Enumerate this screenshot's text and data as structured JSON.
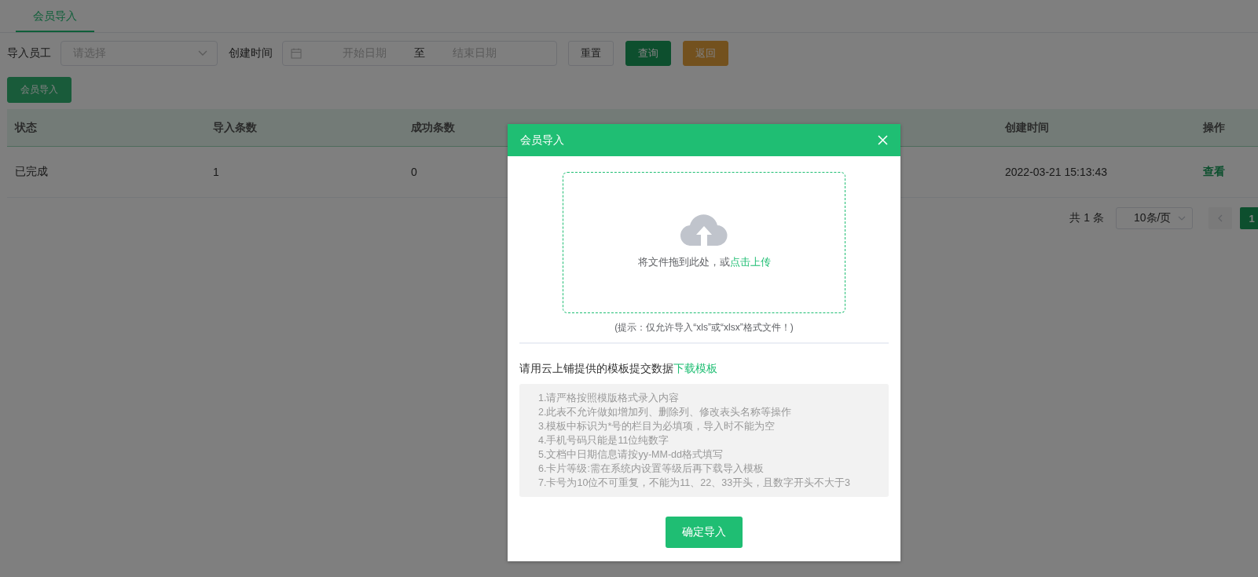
{
  "tabs": [
    {
      "label": "会员导入",
      "selected": true
    }
  ],
  "filters": {
    "employee": {
      "label": "导入员工",
      "placeholder": "请选择"
    },
    "created": {
      "label": "创建时间",
      "start_placeholder": "开始日期",
      "separator": "至",
      "end_placeholder": "结束日期"
    }
  },
  "buttons": [
    {
      "label": "重置",
      "kind": "default"
    },
    {
      "label": "查询",
      "kind": "primary"
    },
    {
      "label": "返回",
      "kind": "warning"
    }
  ],
  "import_button": "会员导入",
  "table": {
    "columns": [
      {
        "label": "状态",
        "kind": "text"
      },
      {
        "label": "导入条数",
        "kind": "text"
      },
      {
        "label": "成功条数",
        "kind": "text"
      },
      {
        "kind": "hidden"
      },
      {
        "kind": "hidden"
      },
      {
        "label": "创建时间",
        "kind": "text"
      },
      {
        "label": "操作",
        "kind": "link"
      }
    ],
    "rows": [
      {
        "cells": [
          "已完成",
          "1",
          "0",
          "2022-03-21 15:13:43",
          "查看"
        ]
      }
    ]
  },
  "pagination": {
    "total": "共 1 条",
    "page_size": "10条/页",
    "pages": [
      {
        "label": "1",
        "selected": true
      }
    ]
  },
  "dialog": {
    "title": "会员导入",
    "upload_text": "将文件拖到此处，或",
    "upload_link": "点击上传",
    "tip": "(提示：仅允许导入“xls”或“xlsx”格式文件！)",
    "template_text": "请用云上铺提供的模板提交数据",
    "template_link": "下载模板",
    "rules": [
      "1.请严格按照模版格式录入内容",
      "2.此表不允许做如增加列、删除列、修改表头名称等操作",
      "3.模板中标识为*号的栏目为必填项，导入时不能为空",
      "4.手机号码只能是11位纯数字",
      "5.文档中日期信息请按yy-MM-dd格式填写",
      "6.卡片等级:需在系统内设置等级后再下载导入模板",
      "7.卡号为10位不可重复，不能为11、22、33开头，且数字开头不大于3"
    ],
    "confirm": "确定导入"
  }
}
